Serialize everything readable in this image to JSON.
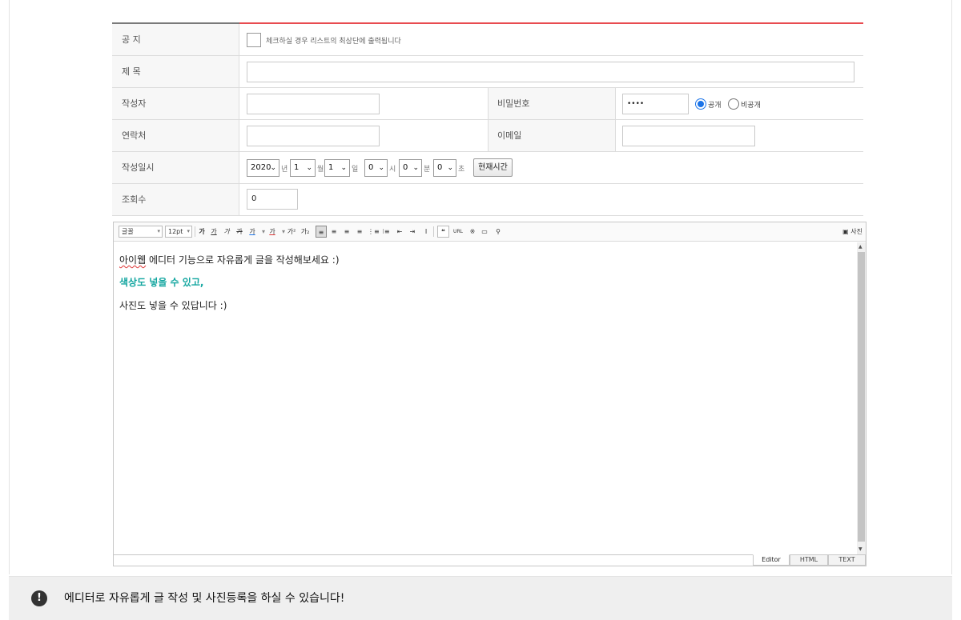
{
  "form": {
    "notice": {
      "label": "공 지",
      "checked": false,
      "note": "체크하실 경우 리스트의 최상단에 출력됩니다"
    },
    "title": {
      "label": "제 목",
      "value": ""
    },
    "author": {
      "label": "작성자",
      "value": ""
    },
    "password": {
      "label": "비밀번호",
      "value": "••••"
    },
    "visibility": {
      "public_label": "공개",
      "private_label": "비공개",
      "selected": "공개"
    },
    "contact": {
      "label": "연락처",
      "value": ""
    },
    "email": {
      "label": "이메일",
      "value": ""
    },
    "datetime": {
      "label": "작성일시",
      "year": "2020",
      "year_unit": "년",
      "month": "1",
      "month_unit": "월",
      "day": "1",
      "day_unit": "일",
      "hour": "0",
      "hour_unit": "시",
      "minute": "0",
      "minute_unit": "분",
      "second": "0",
      "second_unit": "초",
      "now_button": "현재시간"
    },
    "views": {
      "label": "조회수",
      "value": "0"
    }
  },
  "editor": {
    "toolbar": {
      "font": "글꼴",
      "size": "12pt",
      "bold": "가",
      "italic": "가",
      "underline": "가",
      "strike": "가",
      "font_color": "가",
      "bg_color": "가",
      "super": "가²",
      "sub": "가₂",
      "quote": "❝",
      "link": "URL",
      "special": "※",
      "table": "▭",
      "find": "⚲",
      "photo": "사진"
    },
    "content": {
      "line1_a": "아이웹",
      "line1_b": " 에디터 기능으로 자유롭게 글을 작성해보세요 :)",
      "line2": "색상도 넣을 수 있고,",
      "line3": "사진도 넣을 수 있답니다 :)"
    },
    "modes": {
      "editor": "Editor",
      "html": "HTML",
      "text": "TEXT",
      "active": "Editor"
    }
  },
  "footer": {
    "icon": "!",
    "text": "에디터로 자유롭게 글 작성 및 사진등록을 하실 수 있습니다!"
  },
  "colors": {
    "accent_red": "#e84b50",
    "radio_blue": "#1a73e8",
    "teal_text": "#13a6a0"
  }
}
